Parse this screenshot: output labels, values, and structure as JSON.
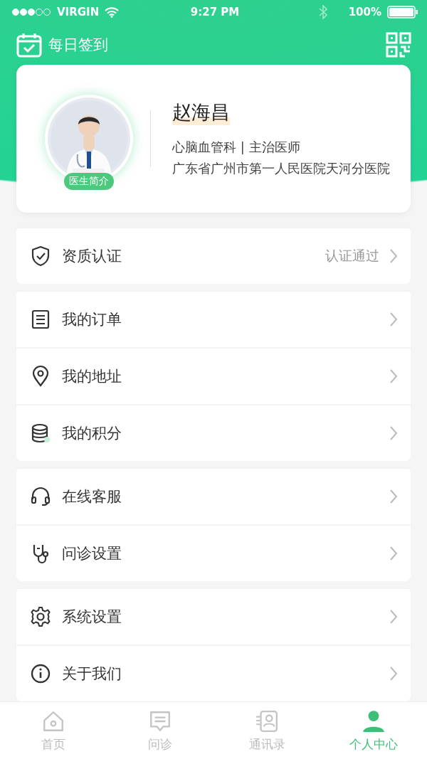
{
  "status_bar": {
    "carrier": "VIRGIN",
    "time": "9:27 PM",
    "battery": "100%"
  },
  "header": {
    "checkin": "每日签到"
  },
  "profile": {
    "name": "赵海昌",
    "department": "心脑血管科 | 主治医师",
    "hospital": "广东省广州市第一人民医院天河分医院",
    "badge": "医生简介"
  },
  "menu_groups": [
    {
      "items": [
        {
          "kind": "shield",
          "label": "资质认证",
          "value": "认证通过"
        }
      ]
    },
    {
      "items": [
        {
          "kind": "list",
          "label": "我的订单"
        },
        {
          "kind": "pin",
          "label": "我的地址"
        },
        {
          "kind": "coins",
          "label": "我的积分"
        }
      ]
    },
    {
      "items": [
        {
          "kind": "headset",
          "label": "在线客服"
        },
        {
          "kind": "stethoscope",
          "label": "问诊设置"
        }
      ]
    },
    {
      "items": [
        {
          "kind": "gear",
          "label": "系统设置"
        },
        {
          "kind": "info",
          "label": "关于我们"
        }
      ]
    }
  ],
  "tab_bar": [
    {
      "kind": "home",
      "label": "首页",
      "selected": false
    },
    {
      "kind": "chat",
      "label": "问诊",
      "selected": false
    },
    {
      "kind": "contacts",
      "label": "通讯录",
      "selected": false
    },
    {
      "kind": "person",
      "label": "个人中心",
      "selected": true
    }
  ]
}
